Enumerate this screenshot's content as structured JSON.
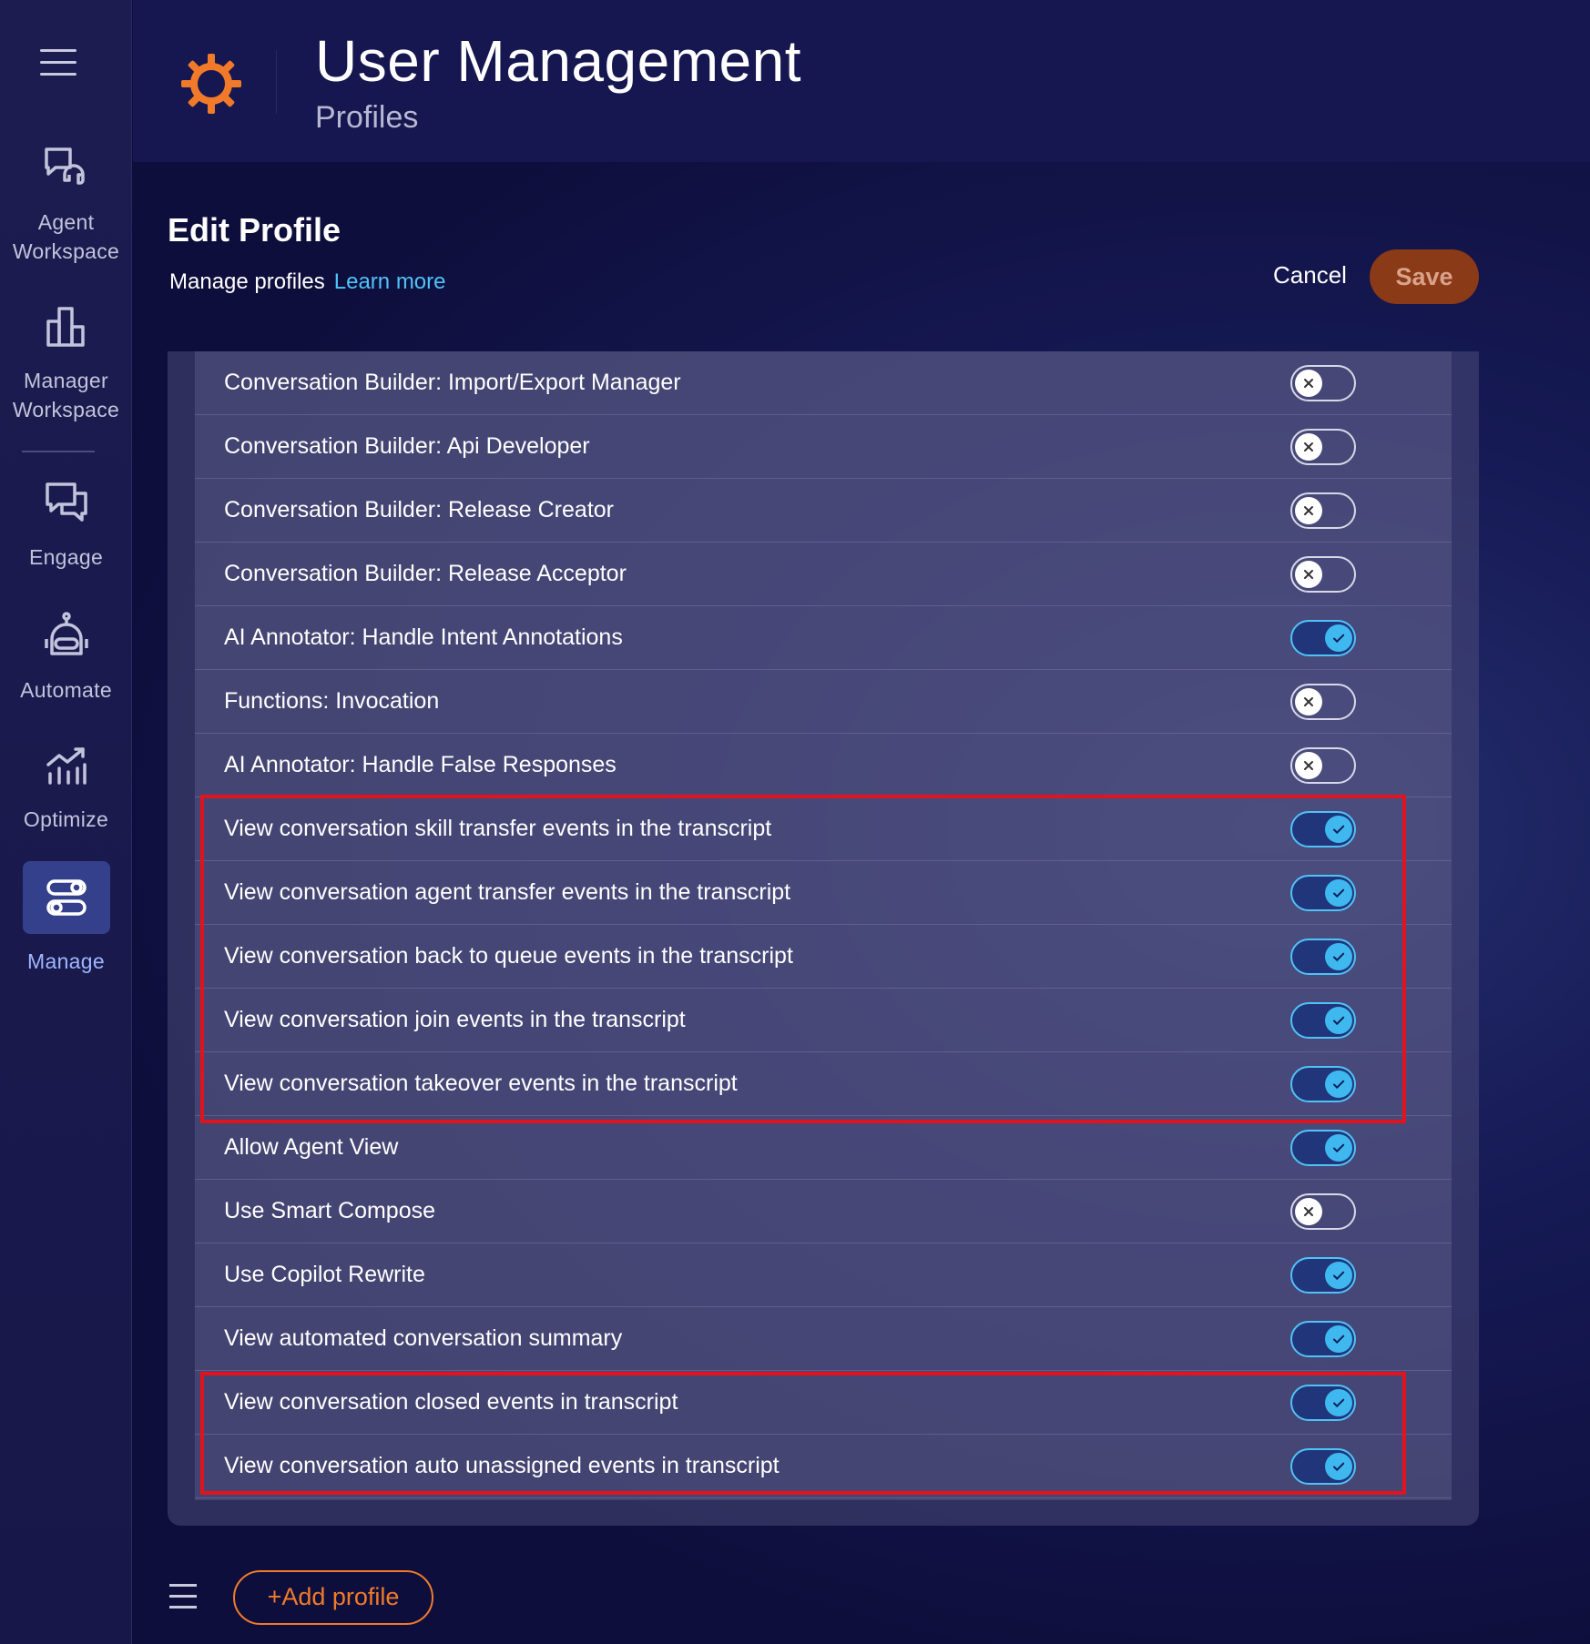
{
  "colors": {
    "accent": "#f07a2a",
    "toggle_on": "#3fb8f0",
    "highlight": "#e0141e",
    "save_bg": "#8b3a17"
  },
  "sidebar": {
    "menu_icon": "hamburger-icon",
    "items": [
      {
        "label": "Agent Workspace",
        "icon": "agent-headset-chat-icon"
      },
      {
        "label": "Manager Workspace",
        "icon": "bar-chart-icon"
      },
      {
        "label": "Engage",
        "icon": "chat-bubbles-icon"
      },
      {
        "label": "Automate",
        "icon": "robot-icon"
      },
      {
        "label": "Optimize",
        "icon": "trend-chart-icon"
      },
      {
        "label": "Manage",
        "icon": "toggles-icon",
        "active": true
      }
    ]
  },
  "header": {
    "title": "User Management",
    "subtitle": "Profiles",
    "logo_icon": "gear-logo-icon"
  },
  "main": {
    "title": "Edit Profile",
    "manage_text": "Manage profiles",
    "learn_more": "Learn more",
    "cancel": "Cancel",
    "save": "Save",
    "permissions": [
      {
        "label": "Conversation Builder: Import/Export Manager",
        "enabled": false
      },
      {
        "label": "Conversation Builder: Api Developer",
        "enabled": false
      },
      {
        "label": "Conversation Builder: Release Creator",
        "enabled": false
      },
      {
        "label": "Conversation Builder: Release Acceptor",
        "enabled": false
      },
      {
        "label": "AI Annotator: Handle Intent Annotations",
        "enabled": true
      },
      {
        "label": "Functions: Invocation",
        "enabled": false
      },
      {
        "label": "AI Annotator: Handle False Responses",
        "enabled": false
      },
      {
        "label": "View conversation skill transfer events in the transcript",
        "enabled": true
      },
      {
        "label": "View conversation agent transfer events in the transcript",
        "enabled": true
      },
      {
        "label": "View conversation back to queue events in the transcript",
        "enabled": true
      },
      {
        "label": "View conversation join events in the transcript",
        "enabled": true
      },
      {
        "label": "View conversation takeover events in the transcript",
        "enabled": true
      },
      {
        "label": "Allow Agent View",
        "enabled": true
      },
      {
        "label": "Use Smart Compose",
        "enabled": false
      },
      {
        "label": "Use Copilot Rewrite",
        "enabled": true
      },
      {
        "label": "View automated conversation summary",
        "enabled": true
      },
      {
        "label": "View conversation closed events in transcript",
        "enabled": true
      },
      {
        "label": "View conversation auto unassigned events in transcript",
        "enabled": true
      }
    ]
  },
  "footer": {
    "menu_icon": "list-icon",
    "add_profile": "+Add profile"
  }
}
